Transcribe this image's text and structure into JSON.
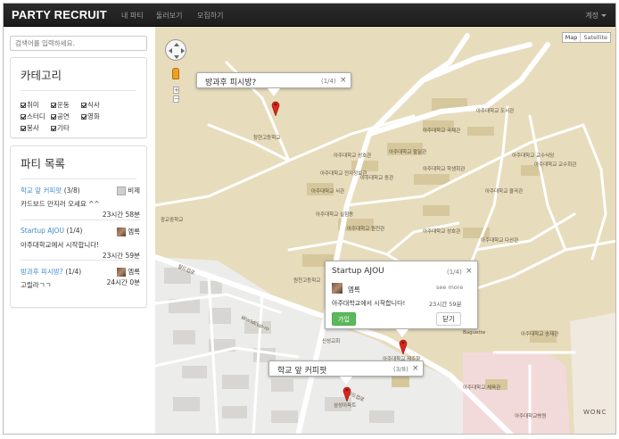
{
  "navbar": {
    "brand": "PARTY RECRUIT",
    "items": [
      "내 파티",
      "둘러보기",
      "모집하기"
    ],
    "account": "계정"
  },
  "sidebar": {
    "search_placeholder": "검색어를 입력하세요.",
    "categories": {
      "title": "카테고리",
      "items": [
        "취미",
        "운동",
        "식사",
        "스터디",
        "공연",
        "영화",
        "봉사",
        "기타"
      ],
      "checked": true
    },
    "party_list": {
      "title": "파티 목록",
      "parties": [
        {
          "title": "학교 앞 커피팟",
          "count": "(3/8)",
          "owner": "비제",
          "description": "카드보드 만지러 오세요 ^^",
          "time": "23시간 58분"
        },
        {
          "title": "Startup AJOU",
          "count": "(1/4)",
          "owner": "엠록",
          "description": "아주대학교에서 시작합니다!",
          "time": "23시간 59분"
        },
        {
          "title": "방과후 피시방?",
          "count": "(1/4)",
          "owner": "엠록",
          "description": "고릴라ㄱㄱ",
          "time": "24시간 0분"
        }
      ]
    }
  },
  "map": {
    "type_buttons": [
      "Map",
      "Satellite"
    ],
    "zoom_in": "+",
    "zoom_out": "−",
    "infowindows": {
      "pc": {
        "title": "방과후 피시방?",
        "count": "(1/4)",
        "close": "×"
      },
      "startup": {
        "title": "Startup AJOU",
        "count": "(1/4)",
        "close": "×",
        "owner": "엠록",
        "see_more": "see more",
        "description": "아주대학교에서 시작합니다!",
        "time": "23시간 59분",
        "join": "가입",
        "dismiss": "닫기"
      },
      "coffee": {
        "title": "학교 앞 커피팟",
        "count": "(3/8)",
        "close": "×"
      }
    },
    "labels": [
      "창현고등학교",
      "아주대학교 성호관",
      "아주대학교 팔달관",
      "아주대학교 경영대학원",
      "아주대학교 원천관",
      "아주대학교 도서관",
      "아주대학교 다산관",
      "아주대학교 율곡관",
      "아주대학교 학생회관",
      "아주대학교 체육관",
      "아주대학교 교수식당",
      "아주대학교 종합관",
      "아주대학교 연암관",
      "신성교회",
      "원천고등학교",
      "광교중학교",
      "아주대학교 제주향",
      "Baguette",
      "WONC",
      "월드컵로",
      "Worldcup-ro",
      "월드컵로",
      "아주대학교 송재관",
      "아주대학교 일신관",
      "아주대학교 산학관",
      "아주대학교 중앙관",
      "월드컵로",
      "아주대학교병원",
      "아주대학교 체육관",
      "삼성아파트",
      "아주대학교 남제관",
      "아주대학교 지속가능관",
      "아주대학교 기숙사사관",
      "아주대학교 교수회관",
      "아주대학교 광교관",
      "아주대학교 국제관",
      "아주대학교 운학관",
      "아주대학교 사무실",
      "아주대학교 성호관",
      "아주대학교 전자정보관",
      "아주대학교 동관",
      "아주대학교 서관",
      "아주대학교 실험동",
      "아주대학교 실험관"
    ]
  },
  "colors": {
    "navbar": "#222222",
    "link": "#428bca",
    "join": "#5cb85c",
    "campus": "#e7dcbc",
    "road": "#ffffff",
    "marker": "#d9261c"
  }
}
